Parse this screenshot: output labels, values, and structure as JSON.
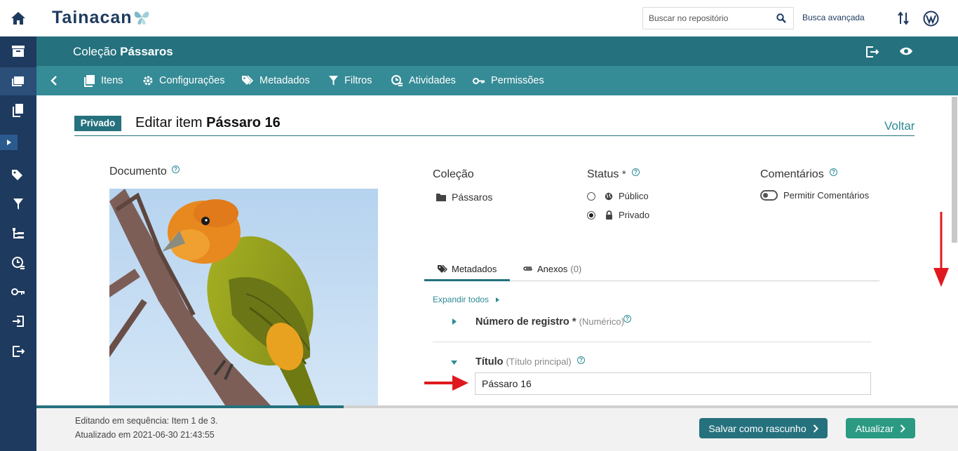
{
  "app": {
    "logo_text": "Tainacan"
  },
  "search": {
    "placeholder": "Buscar no repositório",
    "advanced_label": "Busca avançada"
  },
  "collection": {
    "prefix": "Coleção",
    "name": "Pássaros"
  },
  "tabs": [
    {
      "label": "Itens",
      "icon": "items-icon"
    },
    {
      "label": "Configurações",
      "icon": "gear-icon"
    },
    {
      "label": "Metadados",
      "icon": "tags-icon"
    },
    {
      "label": "Filtros",
      "icon": "filter-icon"
    },
    {
      "label": "Atividades",
      "icon": "activity-icon"
    },
    {
      "label": "Permissões",
      "icon": "key-icon"
    }
  ],
  "page": {
    "status_badge": "Privado",
    "title_prefix": "Editar item",
    "item_name": "Pássaro 16",
    "back_label": "Voltar"
  },
  "document": {
    "label": "Documento"
  },
  "collection_field": {
    "label": "Coleção",
    "value": "Pássaros"
  },
  "status": {
    "label": "Status",
    "required_mark": "*",
    "options": [
      {
        "label": "Público",
        "icon": "globe-icon",
        "selected": false
      },
      {
        "label": "Privado",
        "icon": "lock-icon",
        "selected": true
      }
    ]
  },
  "comments": {
    "label": "Comentários",
    "toggle_label": "Permitir Comentários",
    "enabled": false
  },
  "metadata_tabs": {
    "metadata_label": "Metadados",
    "attachments_label": "Anexos",
    "attachments_count": "(0)"
  },
  "metadata": {
    "expand_all": "Expandir todos",
    "fields": [
      {
        "label": "Número de registro",
        "required_mark": "*",
        "type": "(Numérico)",
        "expanded": false
      },
      {
        "label": "Título",
        "type": "(Título principal)",
        "expanded": true,
        "value": "Pássaro 16"
      }
    ]
  },
  "footer": {
    "sequence_text": "Editando em sequência: Item 1 de 3.",
    "updated_text": "Atualizado em 2021-06-30 21:43:55",
    "draft_button": "Salvar como rascunho",
    "update_button": "Atualizar",
    "sequence_progress": 0.333
  },
  "colors": {
    "sidebar": "#1e3a5f",
    "collection_bar": "#25717e",
    "tab_bar": "#358b96",
    "accent": "#2c8a95",
    "update_button": "#2a9a83",
    "annotation_arrow": "#e0191f"
  }
}
